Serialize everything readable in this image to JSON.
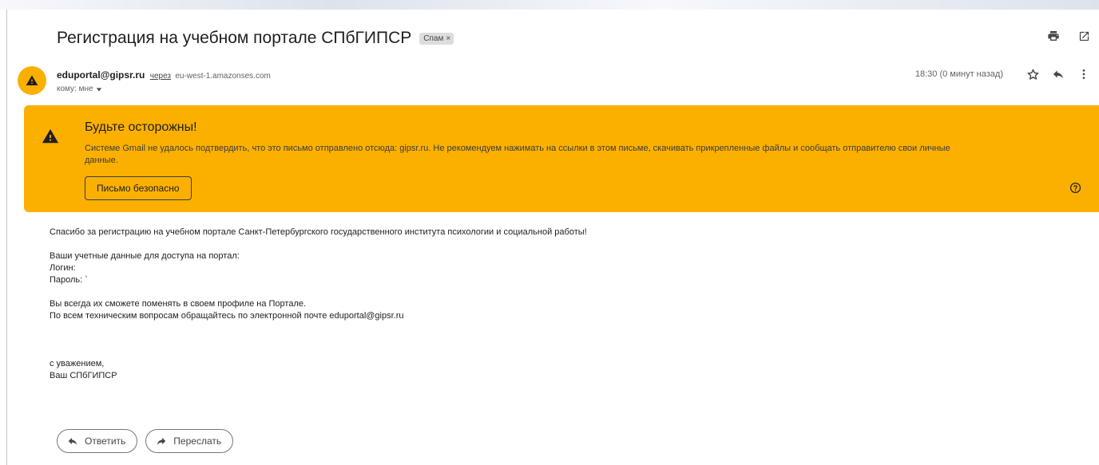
{
  "email": {
    "subject": "Регистрация на учебном портале СПбГИПСР",
    "label": "Спам",
    "label_close": "×",
    "sender_name": "eduportal@gipsr.ru",
    "via_text": "через",
    "via_domain": "eu-west-1.amazonses.com",
    "to_line": "кому: мне",
    "timestamp": "18:30 (0 минут назад)"
  },
  "warning": {
    "title": "Будьте осторожны!",
    "text": "Системе Gmail не удалось подтвердить, что это письмо отправлено отсюда: gipsr.ru. Не рекомендуем нажимать на ссылки в этом письме, скачивать прикрепленные файлы и сообщать отправителю свои личные данные.",
    "button_label": "Письмо безопасно"
  },
  "body": {
    "thanks": "Спасибо за регистрацию на учебном портале Санкт-Петербургского государственного института психологии и социальной работы!",
    "creds_intro": "Ваши учетные данные для доступа на портал:",
    "login": "Логин:",
    "password": "Пароль: `",
    "change_note": "Вы всегда их сможете поменять в своем профиле на Портале.",
    "support_note": "По всем техническим вопросам обращайтесь по электронной почте eduportal@gipsr.ru",
    "regards": "с уважением,",
    "signature": "Ваш СПбГИПСР"
  },
  "actions": {
    "reply_label": "Ответить",
    "forward_label": "Переслать"
  },
  "icons": {
    "print": "printer-icon",
    "open_new": "open-in-new-window-icon",
    "star": "star-icon",
    "reply": "reply-icon",
    "more": "more-vertical-icon",
    "warning": "warning-triangle-icon",
    "help": "help-circle-icon",
    "forward": "forward-icon"
  },
  "colors": {
    "warning_bg": "#fbb000",
    "avatar_bg": "#fbb000",
    "spam_label_bg": "#dddddd"
  }
}
